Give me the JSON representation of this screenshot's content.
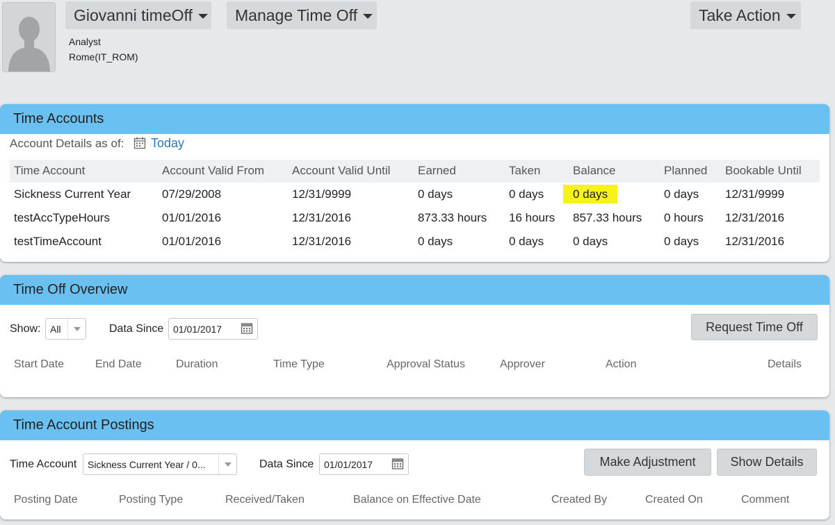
{
  "header": {
    "name_menu": "Giovanni timeOff",
    "manage_menu": "Manage Time Off",
    "action_menu": "Take Action",
    "job_title": "Analyst",
    "location": "Rome(IT_ROM)"
  },
  "time_accounts": {
    "title": "Time Accounts",
    "details_label": "Account Details as of:",
    "date_link": "Today",
    "columns": [
      "Time Account",
      "Account Valid From",
      "Account Valid Until",
      "Earned",
      "Taken",
      "Balance",
      "Planned",
      "Bookable Until"
    ],
    "rows": [
      [
        "Sickness Current Year",
        "07/29/2008",
        "12/31/9999",
        "0 days",
        "0 days",
        "0 days",
        "0 days",
        "12/31/9999"
      ],
      [
        "testAccTypeHours",
        "01/01/2016",
        "12/31/2016",
        "873.33 hours",
        "16 hours",
        "857.33 hours",
        "0 hours",
        "12/31/2016"
      ],
      [
        "testTimeAccount",
        "01/01/2016",
        "12/31/2016",
        "0 days",
        "0 days",
        "0 days",
        "0 days",
        "12/31/2016"
      ]
    ],
    "highlight_color": "#f6f21a"
  },
  "time_off_overview": {
    "title": "Time Off Overview",
    "show_label": "Show:",
    "show_value": "All",
    "data_since_label": "Data Since",
    "data_since_value": "01/01/2017",
    "request_button": "Request Time Off",
    "columns": [
      "Start Date",
      "End Date",
      "Duration",
      "Time Type",
      "Approval Status",
      "Approver",
      "Action",
      "Details"
    ]
  },
  "time_account_postings": {
    "title": "Time Account Postings",
    "account_label": "Time Account",
    "account_value": "Sickness Current Year / 0...",
    "data_since_label": "Data Since",
    "data_since_value": "01/01/2017",
    "adjust_button": "Make Adjustment",
    "details_button": "Show Details",
    "columns": [
      "Posting Date",
      "Posting Type",
      "Received/Taken",
      "Balance on Effective Date",
      "Created By",
      "Created On",
      "Comment"
    ]
  },
  "colors": {
    "panel_header": "#6ac0f0",
    "link": "#2a7ab8",
    "background": "#e6e8ea"
  }
}
